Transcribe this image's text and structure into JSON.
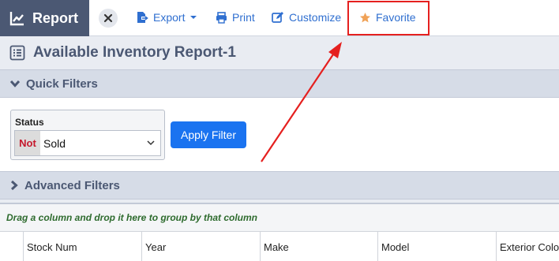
{
  "toolbar": {
    "report_label": "Report",
    "export_label": "Export",
    "print_label": "Print",
    "customize_label": "Customize",
    "favorite_label": "Favorite"
  },
  "page": {
    "title": "Available Inventory Report-1"
  },
  "quick_filters": {
    "header": "Quick Filters",
    "status": {
      "label": "Status",
      "operator": "Not",
      "value": "Sold"
    },
    "apply_label": "Apply Filter"
  },
  "advanced_filters": {
    "header": "Advanced Filters"
  },
  "grid": {
    "group_hint": "Drag a column and drop it here to group by that column",
    "columns": [
      "",
      "Stock Num",
      "Year",
      "Make",
      "Model",
      "Exterior Colo"
    ]
  },
  "colors": {
    "header_bg": "#4b5873",
    "link_blue": "#2f6fd0",
    "apply_blue": "#1a73f0",
    "annotation_red": "#e5201f",
    "favorite_star": "#f0a257"
  },
  "icons": {
    "report": "line-chart-icon",
    "close": "close-icon",
    "export": "export-icon",
    "print": "print-icon",
    "customize": "edit-icon",
    "favorite": "star-icon",
    "title": "list-icon"
  }
}
